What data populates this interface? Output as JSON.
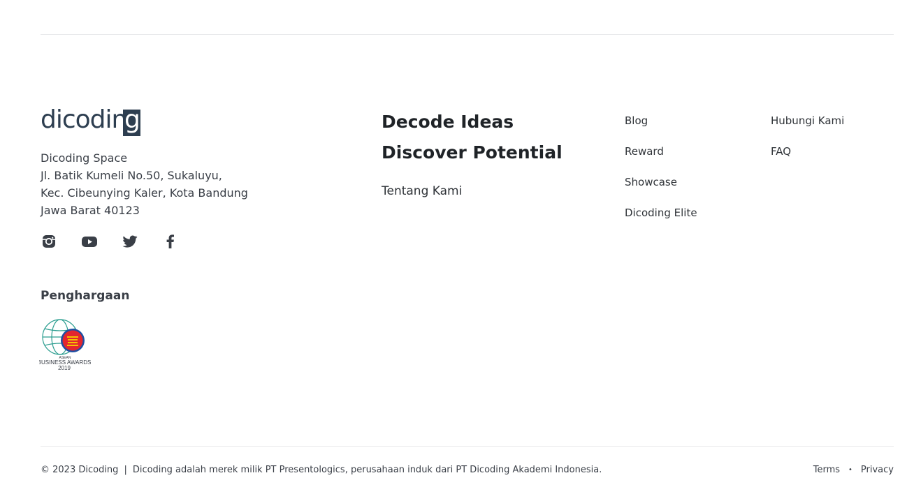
{
  "brand": {
    "name": "dicoding",
    "name_main": "dicodin",
    "name_box": "g"
  },
  "address": {
    "line1": "Dicoding Space",
    "line2": "Jl. Batik Kumeli No.50, Sukaluyu,",
    "line3": "Kec. Cibeunying Kaler, Kota Bandung",
    "line4": "Jawa Barat 40123"
  },
  "socials": [
    {
      "icon": "instagram-icon"
    },
    {
      "icon": "youtube-icon"
    },
    {
      "icon": "twitter-icon"
    },
    {
      "icon": "facebook-icon"
    }
  ],
  "awards": {
    "title": "Penghargaan",
    "badge": {
      "line1": "ASEAN",
      "line2": "BUSINESS AWARDS",
      "line3": "2019"
    }
  },
  "tagline": {
    "line1": "Decode Ideas",
    "line2": "Discover Potential"
  },
  "about_link": "Tentang Kami",
  "links_col1": [
    "Blog",
    "Reward",
    "Showcase",
    "Dicoding Elite"
  ],
  "links_col2": [
    "Hubungi Kami",
    "FAQ"
  ],
  "footer": {
    "copyright": "© 2023 Dicoding",
    "separator": "|",
    "note": "Dicoding adalah merek milik PT Presentologics, perusahaan induk dari PT Dicoding Akademi Indonesia.",
    "terms": "Terms",
    "dot": "•",
    "privacy": "Privacy"
  },
  "colors": {
    "brand": "#2d3e50",
    "rule": "#e8e9eb",
    "asean_red": "#e3262f",
    "asean_gold": "#f5c400",
    "globe_green": "#2a9d8f"
  }
}
